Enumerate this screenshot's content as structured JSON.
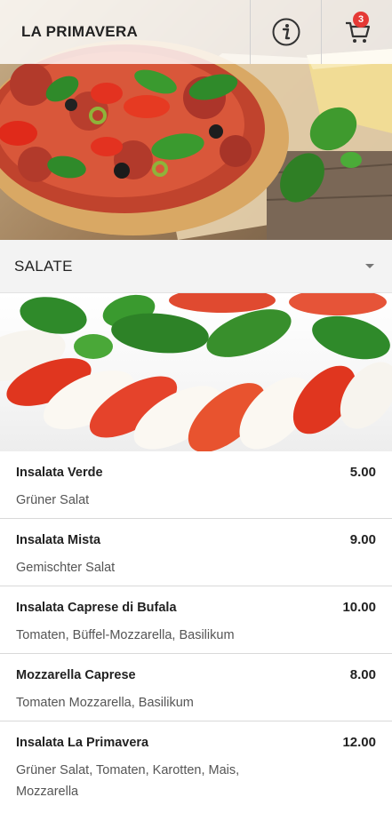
{
  "header": {
    "title": "LA PRIMAVERA",
    "info_icon": "info-icon",
    "cart_icon": "cart-icon",
    "cart_count": "3"
  },
  "hero": {
    "image": "pizza-with-basil-and-cheese"
  },
  "category": {
    "selected": "SALATE",
    "dropdown_icon": "chevron-down-icon",
    "image": "caprese-salad"
  },
  "menu": {
    "items": [
      {
        "name": "Insalata Verde",
        "price": "5.00",
        "desc": "Grüner Salat"
      },
      {
        "name": "Insalata Mista",
        "price": "9.00",
        "desc": "Gemischter Salat"
      },
      {
        "name": "Insalata Caprese di Bufala",
        "price": "10.00",
        "desc": "Tomaten, Büffel-Mozzarella, Basilikum"
      },
      {
        "name": "Mozzarella Caprese",
        "price": "8.00",
        "desc": "Tomaten Mozzarella, Basilikum"
      },
      {
        "name": "Insalata La Primavera",
        "price": "12.00",
        "desc": "Grüner Salat, Tomaten, Karotten, Mais, Mozzarella"
      }
    ]
  },
  "colors": {
    "badge": "#e53935",
    "category_bar": "#f3f3f3",
    "text": "#222222"
  }
}
